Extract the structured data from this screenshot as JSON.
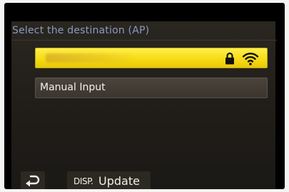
{
  "header": {
    "title": "Select the destination (AP)"
  },
  "access_points": {
    "items": [
      {
        "ssid": "",
        "selected": true,
        "secured": true,
        "icons": [
          "lock-icon",
          "wifi-signal-icon"
        ]
      }
    ],
    "manual_input_label": "Manual Input"
  },
  "footer": {
    "back_icon": "return-icon",
    "disp_key": "DISP.",
    "update_label": "Update"
  },
  "colors": {
    "selection_highlight": "#f6dc15",
    "title_text": "#8a9bc0",
    "menu_background": "#221f1a"
  }
}
